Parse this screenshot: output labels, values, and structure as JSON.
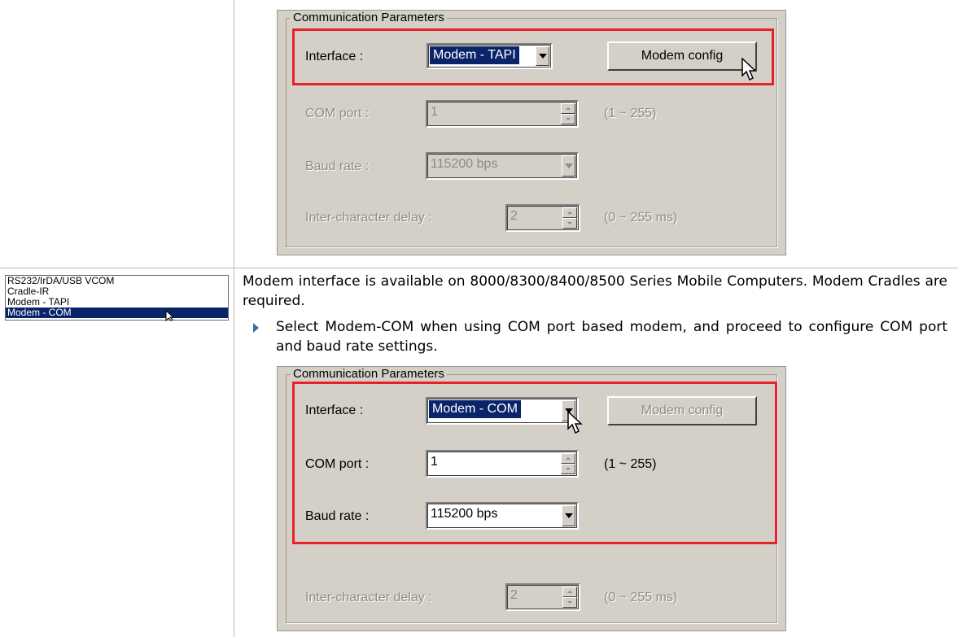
{
  "top_dialog": {
    "legend": "Communication Parameters",
    "interface_label": "Interface :",
    "interface_value": "Modem - TAPI",
    "modem_config_label": "Modem config",
    "com_port_label": "COM port :",
    "com_port_value": "1",
    "com_port_range": "(1 ~ 255)",
    "baud_rate_label": "Baud rate :",
    "baud_rate_value": "115200 bps",
    "delay_label": "Inter-character delay :",
    "delay_value": "2",
    "delay_range": "(0 ~ 255 ms)"
  },
  "interface_list": {
    "items": [
      "RS232/IrDA/USB VCOM",
      "Cradle-IR",
      "Modem - TAPI",
      "Modem - COM"
    ],
    "selected": "Modem - COM"
  },
  "description": {
    "paragraph": "Modem interface is available on 8000/8300/8400/8500 Series Mobile Computers. Modem Cradles are required.",
    "bullet": "Select Modem-COM when using COM port based modem, and proceed to configure COM port and baud rate settings."
  },
  "bottom_dialog": {
    "legend": "Communication Parameters",
    "interface_label": "Interface :",
    "interface_value": "Modem - COM",
    "modem_config_label": "Modem config",
    "com_port_label": "COM port :",
    "com_port_value": "1",
    "com_port_range": "(1 ~ 255)",
    "baud_rate_label": "Baud rate :",
    "baud_rate_value": "115200 bps",
    "delay_label": "Inter-character delay :",
    "delay_value": "2",
    "delay_range": "(0 ~ 255 ms)"
  },
  "colors": {
    "highlight_box": "#e8202a",
    "selection": "#0a246a",
    "dialog_bg": "#d4d0c8",
    "bullet": "#3a6fa6"
  }
}
